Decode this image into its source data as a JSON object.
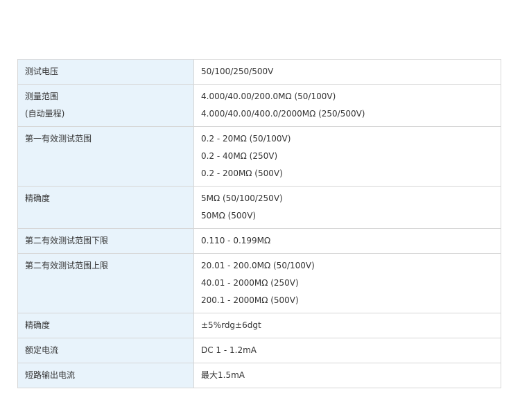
{
  "rows": [
    {
      "label": [
        "测试电压"
      ],
      "values": [
        "50/100/250/500V"
      ]
    },
    {
      "label": [
        "测量范围",
        "(自动量程)"
      ],
      "values": [
        "4.000/40.00/200.0MΩ (50/100V)",
        "4.000/40.00/400.0/2000MΩ (250/500V)"
      ]
    },
    {
      "label": [
        "第一有效测试范围"
      ],
      "values": [
        "0.2 - 20MΩ (50/100V)",
        "0.2 - 40MΩ (250V)",
        "0.2 - 200MΩ (500V)"
      ]
    },
    {
      "label": [
        "精确度"
      ],
      "values": [
        "5MΩ (50/100/250V)",
        "50MΩ (500V)"
      ]
    },
    {
      "label": [
        "第二有效测试范围下限"
      ],
      "values": [
        "0.110 - 0.199MΩ"
      ]
    },
    {
      "label": [
        "第二有效测试范围上限"
      ],
      "values": [
        "20.01 - 200.0MΩ (50/100V)",
        "40.01 - 2000MΩ (250V)",
        "200.1 - 2000MΩ (500V)"
      ]
    },
    {
      "label": [
        "精确度"
      ],
      "values": [
        "±5%rdg±6dgt"
      ]
    },
    {
      "label": [
        "额定电流"
      ],
      "values": [
        "DC 1 - 1.2mA"
      ]
    },
    {
      "label": [
        "短路输出电流"
      ],
      "values": [
        "最大1.5mA"
      ]
    }
  ]
}
